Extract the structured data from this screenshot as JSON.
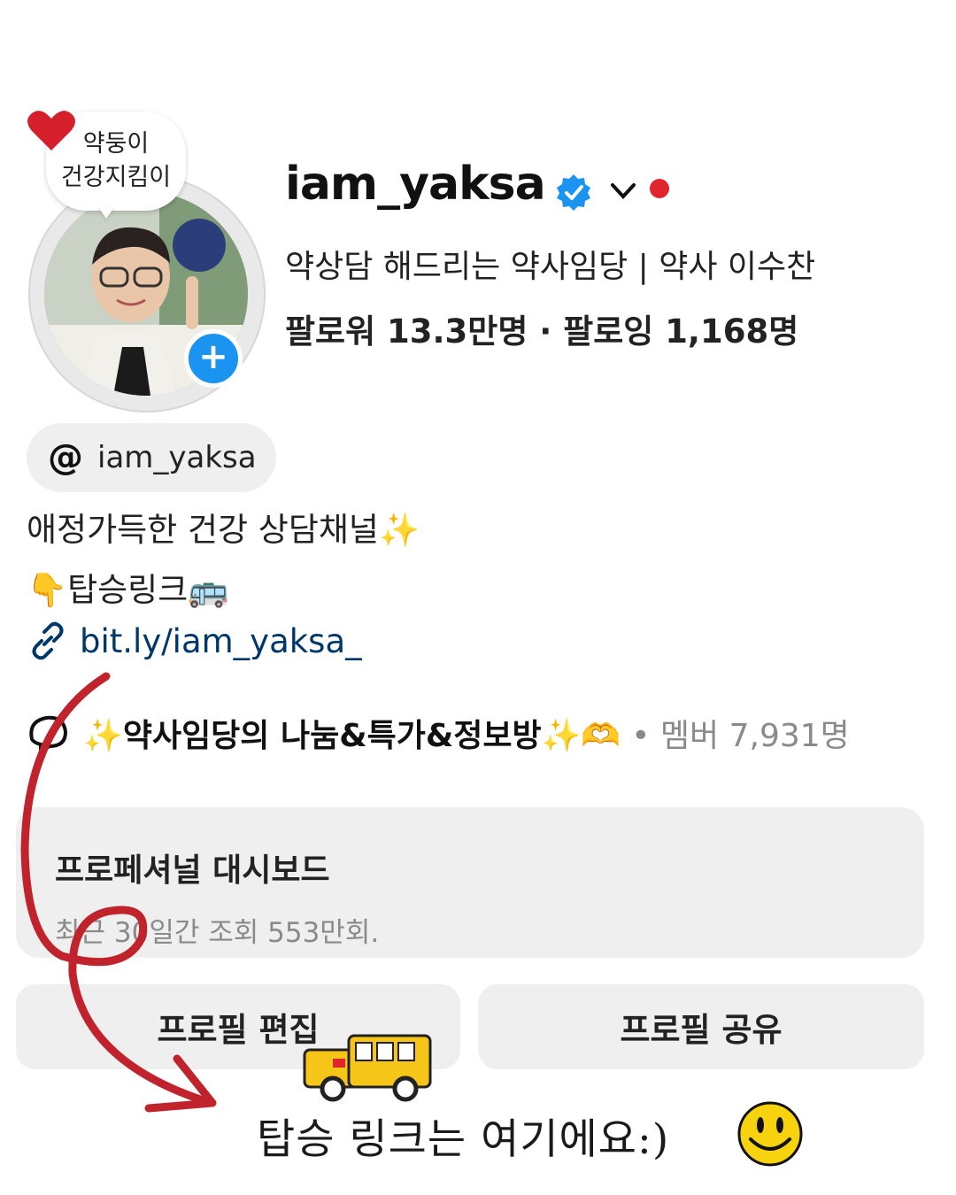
{
  "sticker": {
    "line1": "약둥이",
    "line2": "건강지킴이",
    "heart_color": "#d5202c"
  },
  "profile": {
    "username": "iam_yaksa",
    "verified": true,
    "category": "약상담 해드리는 약사임당 | 약사 이수찬",
    "stats": "팔로워 13.3만명 · 팔로잉 1,168명",
    "threads_handle": "iam_yaksa"
  },
  "bio": {
    "line1": "애정가득한 건강 상담채널✨",
    "line2": "👇탑승링크🚌",
    "link": "bit.ly/iam_yaksa_"
  },
  "channel": {
    "name": "✨약사임당의 나눔&특가&정보방✨🫶",
    "members": "• 멤버 7,931명"
  },
  "dashboard": {
    "title": "프로페셔널 대시보드",
    "subtitle": "최근 30일간 조회 553만회."
  },
  "buttons": {
    "edit": "프로필 편집",
    "share": "프로필 공유"
  },
  "caption": "탑승 링크는 여기에요:)",
  "colors": {
    "accent_blue": "#1a94f0",
    "link": "#00376b",
    "live": "#e0252c",
    "arrow": "#c0232b",
    "panel": "#efefef"
  }
}
